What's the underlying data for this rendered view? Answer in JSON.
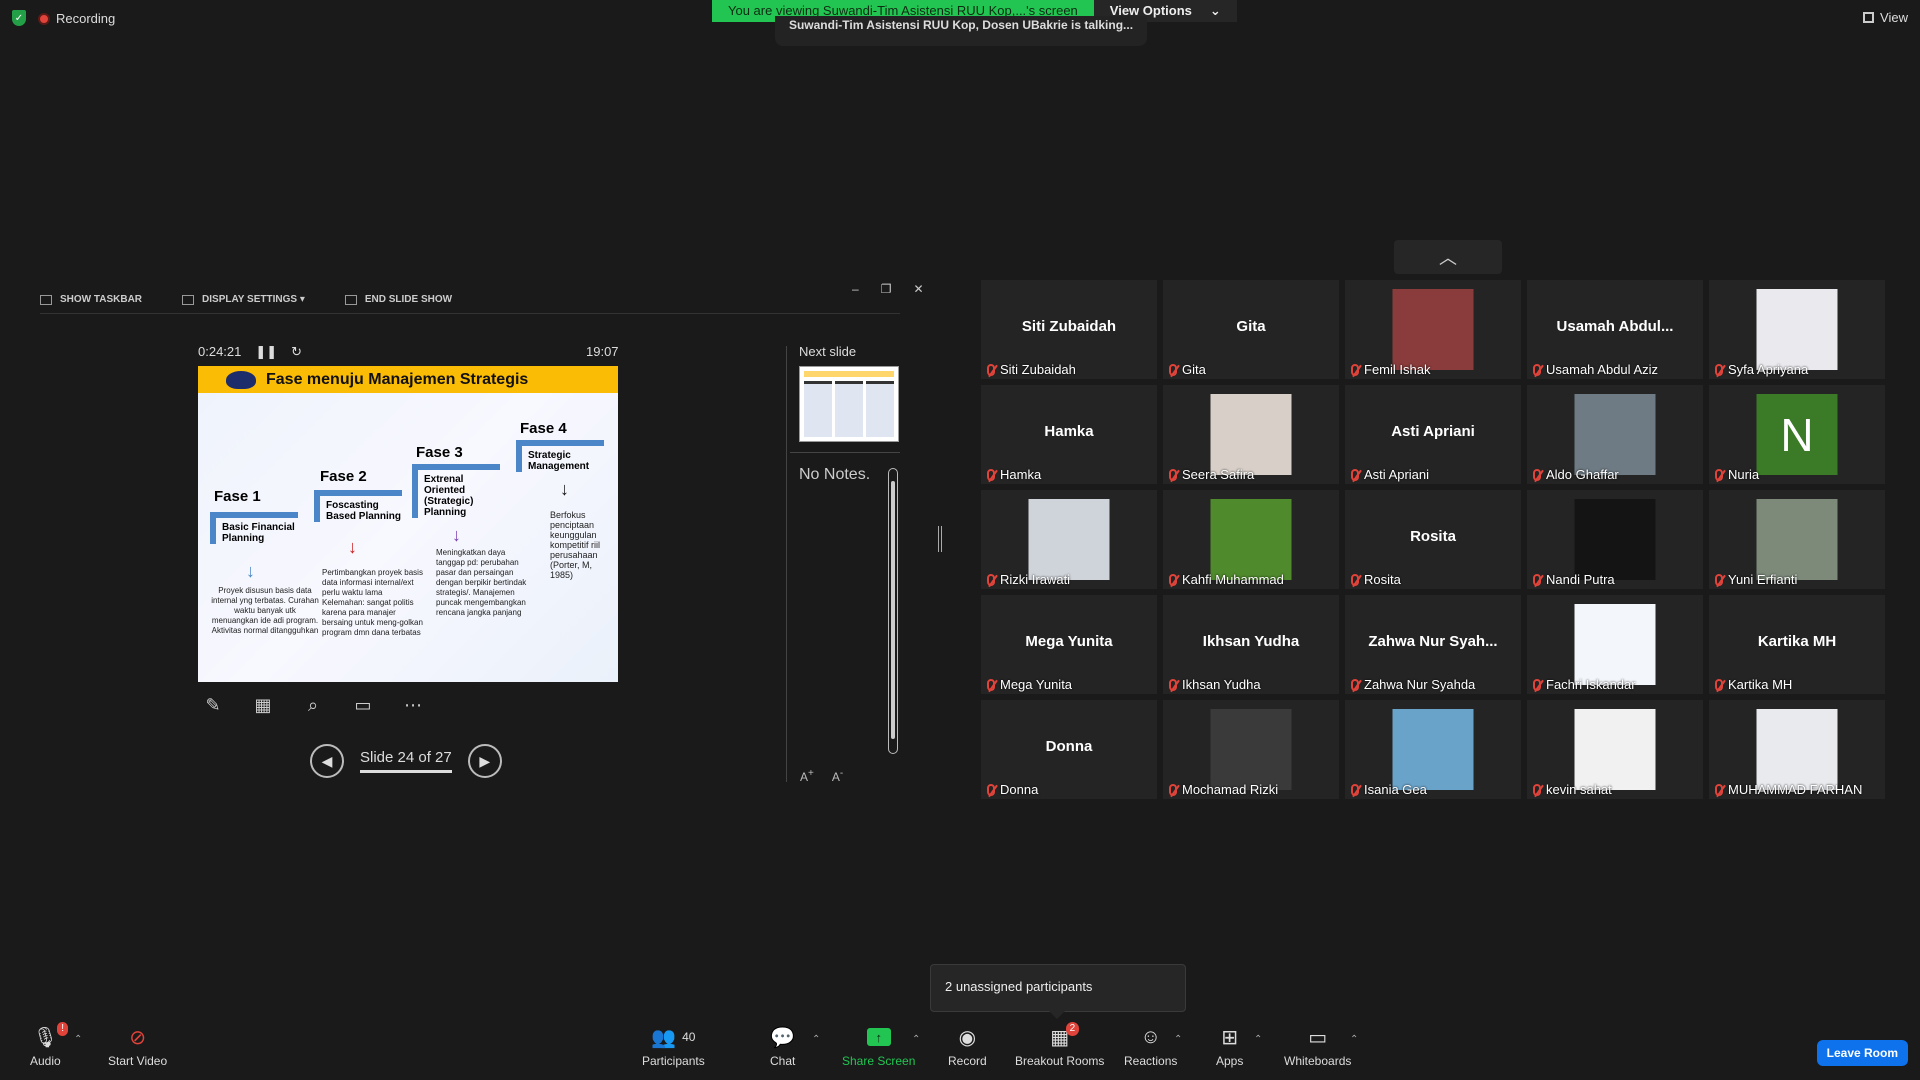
{
  "topbar": {
    "recording_label": "Recording",
    "view_banner": "You are viewing Suwandi-Tim Asistensi RUU Kop,...'s screen",
    "view_options": "View Options",
    "talking": "Suwandi-Tim Asistensi RUU Kop, Dosen UBakrie is talking...",
    "view_label": "View"
  },
  "slideshow": {
    "show_taskbar": "SHOW TASKBAR",
    "display_settings": "DISPLAY SETTINGS ▾",
    "end_slide_show": "END SLIDE SHOW",
    "elapsed": "0:24:21",
    "clock": "19:07",
    "slide_label": "Slide 24 of 27",
    "next_slide_label": "Next slide",
    "no_notes": "No Notes."
  },
  "slide": {
    "title": "Fase menuju Manajemen Strategis",
    "phases": [
      {
        "heading": "Fase 1",
        "sub": "Basic Financial Planning",
        "desc": "Proyek disusun basis data internal yng terbatas. Curahan waktu banyak utk menuangkan ide adi program. Aktivitas normal ditangguhkan"
      },
      {
        "heading": "Fase 2",
        "sub": "Foscasting Based Planning",
        "desc": "Pertimbangkan proyek basis data informasi internal/ext perlu waktu lama Kelemahan: sangat politis karena para manajer bersaing untuk meng-golkan program dmn dana terbatas"
      },
      {
        "heading": "Fase 3",
        "sub": "Extrenal Oriented (Strategic) Planning",
        "desc": "Meningkatkan daya tanggap pd: perubahan pasar dan persaingan dengan berpikir bertindak strategis/. Manajemen puncak mengembangkan rencana jangka panjang"
      },
      {
        "heading": "Fase 4",
        "sub": "Strategic Management",
        "desc": "Berfokus penciptaan keunggulan kompetitif riil perusahaan (Porter, M, 1985)"
      }
    ]
  },
  "participants": [
    {
      "big": "Siti Zubaidah",
      "label": "Siti Zubaidah",
      "pic": ""
    },
    {
      "big": "Gita",
      "label": "Gita",
      "pic": ""
    },
    {
      "big": "",
      "label": "Femil Ishak",
      "pic": "#8a3b3b"
    },
    {
      "big": "Usamah Abdul...",
      "label": "Usamah Abdul Aziz",
      "pic": ""
    },
    {
      "big": "",
      "label": "Syfa Apriyana",
      "pic": "#e9e9ee"
    },
    {
      "big": "Hamka",
      "label": "Hamka",
      "pic": ""
    },
    {
      "big": "",
      "label": "Seera Safira",
      "pic": "#d8cfc8"
    },
    {
      "big": "Asti Apriani",
      "label": "Asti Apriani",
      "pic": ""
    },
    {
      "big": "",
      "label": "Aldo Ghaffar",
      "pic": "#6e7b84"
    },
    {
      "big": "",
      "label": "Nuria",
      "pic": "N"
    },
    {
      "big": "",
      "label": "Rizki Irawati",
      "pic": "#cfd4da"
    },
    {
      "big": "",
      "label": "Kahfi Muhammad",
      "pic": "#4f8a2c"
    },
    {
      "big": "Rosita",
      "label": "Rosita",
      "pic": ""
    },
    {
      "big": "",
      "label": "Nandi Putra",
      "pic": "#141414"
    },
    {
      "big": "",
      "label": "Yuni Erfianti",
      "pic": "#7d8a7a"
    },
    {
      "big": "Mega Yunita",
      "label": "Mega Yunita",
      "pic": ""
    },
    {
      "big": "Ikhsan Yudha",
      "label": "Ikhsan Yudha",
      "pic": ""
    },
    {
      "big": "Zahwa Nur Syah...",
      "label": "Zahwa Nur Syahda",
      "pic": ""
    },
    {
      "big": "",
      "label": "Fachri Iskandar",
      "pic": "#f3f6fb"
    },
    {
      "big": "Kartika MH",
      "label": "Kartika MH",
      "pic": ""
    },
    {
      "big": "Donna",
      "label": "Donna",
      "pic": ""
    },
    {
      "big": "",
      "label": "Mochamad Rizki",
      "pic": "#3a3a3a"
    },
    {
      "big": "",
      "label": "Isania Gea",
      "pic": "#6aa3c9"
    },
    {
      "big": "",
      "label": "kevin sahat",
      "pic": "#f1f1f1"
    },
    {
      "big": "",
      "label": "MUHAMMAD FARHAN",
      "pic": "#e8eaee"
    }
  ],
  "popup": {
    "unassigned": "2 unassigned participants"
  },
  "toolbar": {
    "audio": "Audio",
    "start_video": "Start Video",
    "participants": "Participants",
    "participants_count": "40",
    "chat": "Chat",
    "share_screen": "Share Screen",
    "record": "Record",
    "breakout_rooms": "Breakout Rooms",
    "breakout_badge": "2",
    "reactions": "Reactions",
    "apps": "Apps",
    "whiteboards": "Whiteboards",
    "leave_room": "Leave Room",
    "audio_badge": "!"
  },
  "colors": {
    "accent_green": "#23c552",
    "leave_blue": "#0e72ed",
    "muted_red": "#e0433a",
    "slide_title_bg": "#fbbc05"
  }
}
